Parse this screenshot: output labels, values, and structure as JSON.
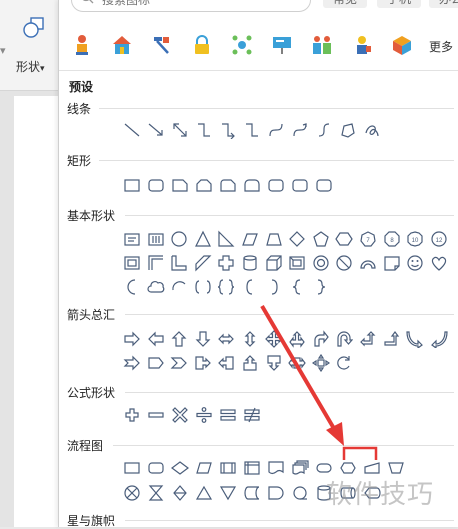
{
  "ribbon": {
    "shape_button_label": "形状",
    "dropdown_caret": "▾"
  },
  "search": {
    "placeholder": "搜索图标"
  },
  "chips": [
    "常见",
    "手机",
    "办公"
  ],
  "quick_icons": [
    "worker-icon",
    "house-icon",
    "tools-icon",
    "lock-icon",
    "molecule-icon",
    "presentation-icon",
    "team-icon",
    "engineer-icon",
    "box-icon"
  ],
  "more_label": "更多",
  "preset_title": "预设",
  "sections": [
    {
      "title": "线条"
    },
    {
      "title": "矩形"
    },
    {
      "title": "基本形状"
    },
    {
      "title": "箭头总汇"
    },
    {
      "title": "公式形状"
    },
    {
      "title": "流程图"
    },
    {
      "title": "星与旗帜"
    }
  ],
  "watermark": "软件技巧",
  "colors": {
    "annotation_red": "#e53935",
    "stroke": "#4a5d7a"
  }
}
